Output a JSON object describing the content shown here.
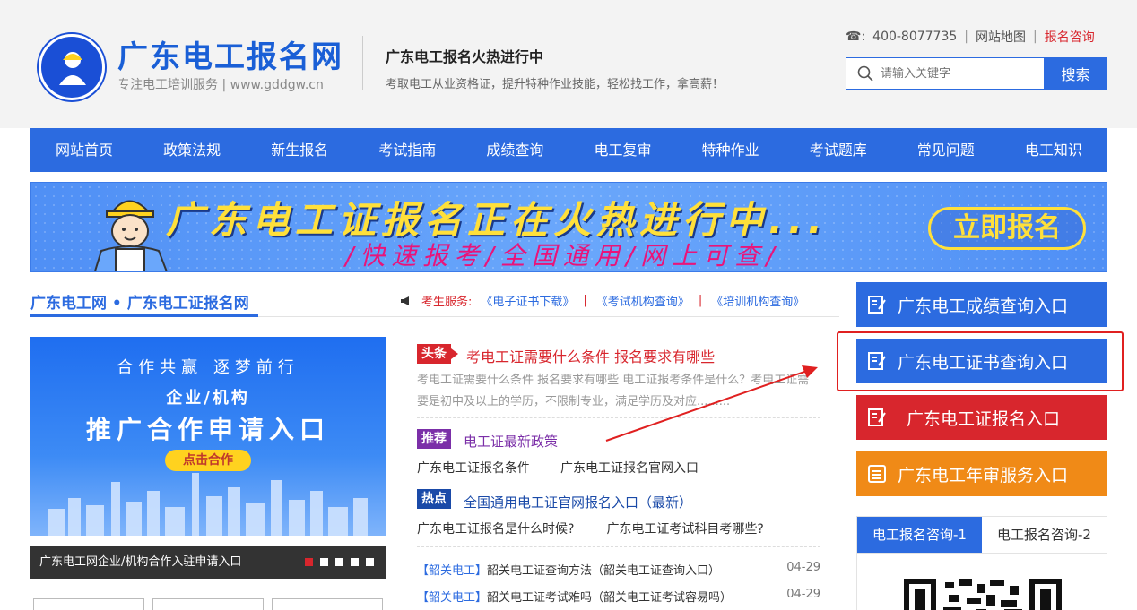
{
  "header": {
    "site_title": "广东电工报名网",
    "site_subtitle": "专注电工培训服务 | www.gddgw.cn",
    "tagline_title": "广东电工报名火热进行中",
    "tagline_desc": "考取电工从业资格证，提升特种作业技能，轻松找工作，拿高薪！",
    "phone_label": "☎:",
    "phone": "400-8077735",
    "sitemap": "网站地图",
    "consult": "报名咨询",
    "separator": "|",
    "search_placeholder": "请输入关键字",
    "search_button": "搜索"
  },
  "nav": [
    "网站首页",
    "政策法规",
    "新生报名",
    "考试指南",
    "成绩查询",
    "电工复审",
    "特种作业",
    "考试题库",
    "常见问题",
    "电工知识"
  ],
  "banner": {
    "headline": "广东电工证报名正在火热进行中...",
    "subline": "/快速报考/全国通用/网上可查/",
    "cta": "立即报名"
  },
  "section": {
    "title": "广东电工网 • 广东电工证报名网",
    "services_label": "考生服务:",
    "services": [
      "《电子证书下载》",
      "《考试机构查询》",
      "《培训机构查询》"
    ]
  },
  "promo": {
    "line1": "合作共赢  逐梦前行",
    "line2": "企业/机构",
    "line3": "推广合作申请入口",
    "button": "点击合作",
    "caption": "广东电工网企业/机构合作入驻申请入口"
  },
  "news": {
    "top_tag": "头条",
    "top_title": "考电工证需要什么条件 报名要求有哪些",
    "top_summary": "考电工证需要什么条件 报名要求有哪些      电工证报考条件是什么？考电工证需要是初中及以上的学历，不限制专业，满足学历及对应.........",
    "rec_tag": "推荐",
    "rec_title": "电工证最新政策",
    "rec_items": [
      "广东电工证报名条件",
      "广东电工证报名官网入口"
    ],
    "hot_tag": "热点",
    "hot_title": "全国通用电工证官网报名入口（最新）",
    "hot_items": [
      "广东电工证报名是什么时候?",
      "广东电工证考试科目考哪些?"
    ],
    "list": [
      {
        "cat": "【韶关电工】",
        "title": "韶关电工证查询方法（韶关电工证查询入口）",
        "date": "04-29"
      },
      {
        "cat": "【韶关电工】",
        "title": "韶关电工证考试难吗（韶关电工证考试容易吗）",
        "date": "04-29"
      }
    ]
  },
  "entries": {
    "score": "广东电工成绩查询入口",
    "cert": "广东电工证书查询入口",
    "reg": "广东电工证报名入口",
    "review": "广东电工年审服务入口"
  },
  "consult_tabs": [
    "电工报名咨询-1",
    "电工报名咨询-2"
  ],
  "colors": {
    "brand": "#2c6be0",
    "red": "#d8262d",
    "orange": "#f08a17",
    "purple": "#7b2fa8"
  }
}
